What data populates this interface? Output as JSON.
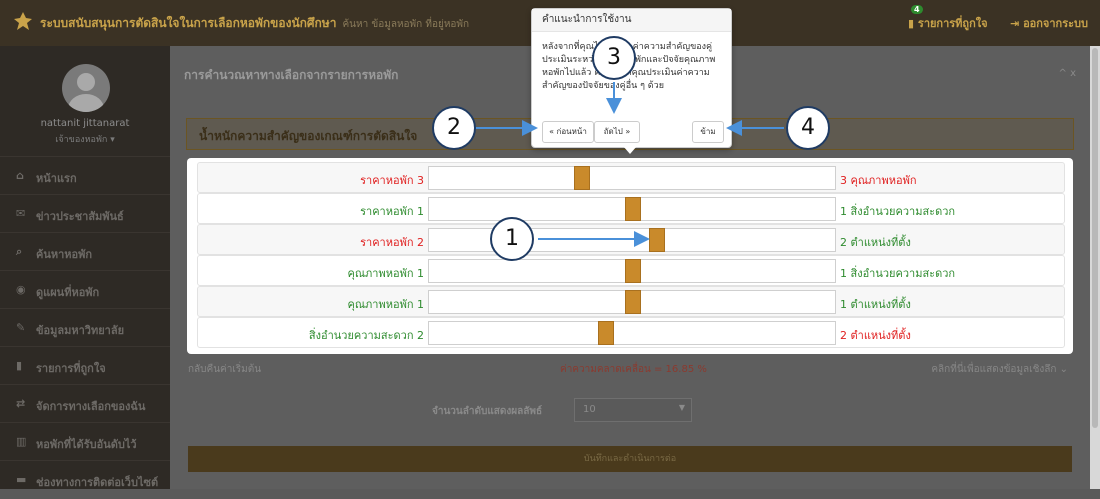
{
  "header": {
    "app_title": "ระบบสนับสนุนการตัดสินใจในการเลือกหอพักของนักศึกษา",
    "sub_title": "ค้นหา ข้อมูลหอพัก ที่อยู่หอพัก",
    "favorites_label": "รายการที่ถูกใจ",
    "favorites_count": "4",
    "logout_label": "ออกจากระบบ"
  },
  "user": {
    "name": "nattanit jittanarat",
    "role": "เจ้าของหอพัก ▾"
  },
  "sidebar": {
    "items": [
      {
        "icon": "home-icon",
        "glyph": "⌂",
        "label": "หน้าแรก"
      },
      {
        "icon": "megaphone-icon",
        "glyph": "✉",
        "label": "ข่าวประชาสัมพันธ์"
      },
      {
        "icon": "search-icon",
        "glyph": "⌕",
        "label": "ค้นหาหอพัก"
      },
      {
        "icon": "map-marker-icon",
        "glyph": "◉",
        "label": "ดูแผนที่หอพัก"
      },
      {
        "icon": "graduation-cap-icon",
        "glyph": "✎",
        "label": "ข้อมูลมหาวิทยาลัย"
      },
      {
        "icon": "bookmark-icon",
        "glyph": "▮",
        "label": "รายการที่ถูกใจ"
      },
      {
        "icon": "exchange-icon",
        "glyph": "⇄",
        "label": "จัดการทางเลือกของฉัน"
      },
      {
        "icon": "bar-chart-icon",
        "glyph": "▥",
        "label": "หอพักที่ได้รับอันดับไว้"
      },
      {
        "icon": "comment-icon",
        "glyph": "▬",
        "label": "ช่องทางการติดต่อเว็บไซต์"
      }
    ]
  },
  "main": {
    "panel_title": "การคำนวณหาทางเลือกจากรายการหอพัก",
    "panel_controls": "^ x",
    "weight_title": "น้ำหนักความสำคัญของเกณฑ์การตัดสินใจ",
    "reset_label": "กลับคืนค่าเริ่มต้น",
    "consistency_label": "ค่าความคลาดเคลื่อน = 16.85 %",
    "detail_label": "คลิกที่นี่เพื่อแสดงข้อมูลเชิงลึก ⌄",
    "result_count_label": "จำนวนลำดับแสดงผลลัพธ์",
    "result_count_value": "10",
    "save_label": "บันทึกและดำเนินการต่อ"
  },
  "comparisons": [
    {
      "left": "ราคาหอพัก 3",
      "left_red": true,
      "right": "3 คุณภาพหอพัก",
      "right_red": true,
      "value": 0.37
    },
    {
      "left": "ราคาหอพัก 1",
      "left_red": false,
      "right": "1 สิ่งอำนวยความสะดวก",
      "right_red": false,
      "value": 0.5
    },
    {
      "left": "ราคาหอพัก 2",
      "left_red": true,
      "right": "2 ตำแหน่งที่ตั้ง",
      "right_red": false,
      "value": 0.56
    },
    {
      "left": "คุณภาพหอพัก 1",
      "left_red": false,
      "right": "1 สิ่งอำนวยความสะดวก",
      "right_red": false,
      "value": 0.5
    },
    {
      "left": "คุณภาพหอพัก 1",
      "left_red": false,
      "right": "1 ตำแหน่งที่ตั้ง",
      "right_red": false,
      "value": 0.5
    },
    {
      "left": "สิ่งอำนวยความสะดวก 2",
      "left_red": false,
      "right": "2 ตำแหน่งที่ตั้ง",
      "right_red": true,
      "value": 0.43
    }
  ],
  "tour": {
    "title": "คำแนะนำการใช้งาน",
    "body": "หลังจากที่คุณได้กำหนดค่าความสำคัญของคู่ประเมินระหว่างราคาหอพักและปัจจัยคุณภาพหอพักไปแล้ว คราวนี้ให้คุณประเมินค่าความสำคัญของปัจจัยของคู่อื่น ๆ ด้วย",
    "prev_label": "« ก่อนหน้า",
    "next_label": "ถัดไป »",
    "skip_label": "ข้าม"
  },
  "annotations": [
    "1",
    "2",
    "3",
    "4"
  ],
  "colors": {
    "accent": "#c9a34a",
    "slider_thumb": "#c98a2b",
    "green_text": "#2e8b2e",
    "red_text": "#e02020",
    "annotation_border": "#1f3b63",
    "annotation_arrow": "#4a90d9"
  }
}
